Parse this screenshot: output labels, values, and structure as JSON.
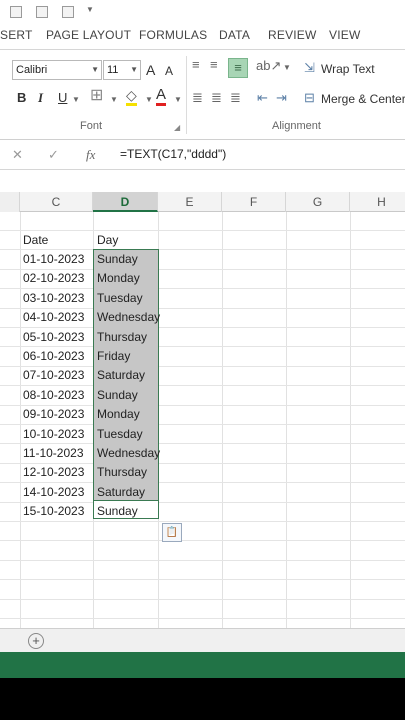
{
  "ribbon_tabs": [
    "SERT",
    "PAGE LAYOUT",
    "FORMULAS",
    "DATA",
    "REVIEW",
    "VIEW"
  ],
  "font": {
    "family": "Calibri",
    "size": "11",
    "grow_label": "A",
    "shrink_label": "A",
    "bold": "B",
    "italic": "I",
    "underline": "U",
    "font_color_letter": "A",
    "group_label": "Font"
  },
  "alignment": {
    "wrap_text": "Wrap Text",
    "merge_center": "Merge & Center",
    "group_label": "Alignment"
  },
  "formula_bar": {
    "cancel": "✕",
    "enter": "✓",
    "fx": "fx",
    "formula": "=TEXT(C17,\"dddd\")"
  },
  "columns": [
    "C",
    "D",
    "E",
    "F",
    "G",
    "H"
  ],
  "selected_column": "D",
  "headers": {
    "date": "Date",
    "day": "Day"
  },
  "rows": [
    {
      "date": "01-10-2023",
      "day": "Sunday"
    },
    {
      "date": "02-10-2023",
      "day": "Monday"
    },
    {
      "date": "03-10-2023",
      "day": "Tuesday"
    },
    {
      "date": "04-10-2023",
      "day": "Wednesday"
    },
    {
      "date": "05-10-2023",
      "day": "Thursday"
    },
    {
      "date": "06-10-2023",
      "day": "Friday"
    },
    {
      "date": "07-10-2023",
      "day": "Saturday"
    },
    {
      "date": "08-10-2023",
      "day": "Sunday"
    },
    {
      "date": "09-10-2023",
      "day": "Monday"
    },
    {
      "date": "10-10-2023",
      "day": "Tuesday"
    },
    {
      "date": "11-10-2023",
      "day": "Wednesday"
    },
    {
      "date": "12-10-2023",
      "day": "Thursday"
    },
    {
      "date": "14-10-2023",
      "day": "Saturday"
    },
    {
      "date": "15-10-2023",
      "day": "Sunday"
    }
  ],
  "sheet": {
    "add_sheet": "+"
  },
  "colors": {
    "accent": "#217346",
    "selection": "#c6c6c6"
  }
}
